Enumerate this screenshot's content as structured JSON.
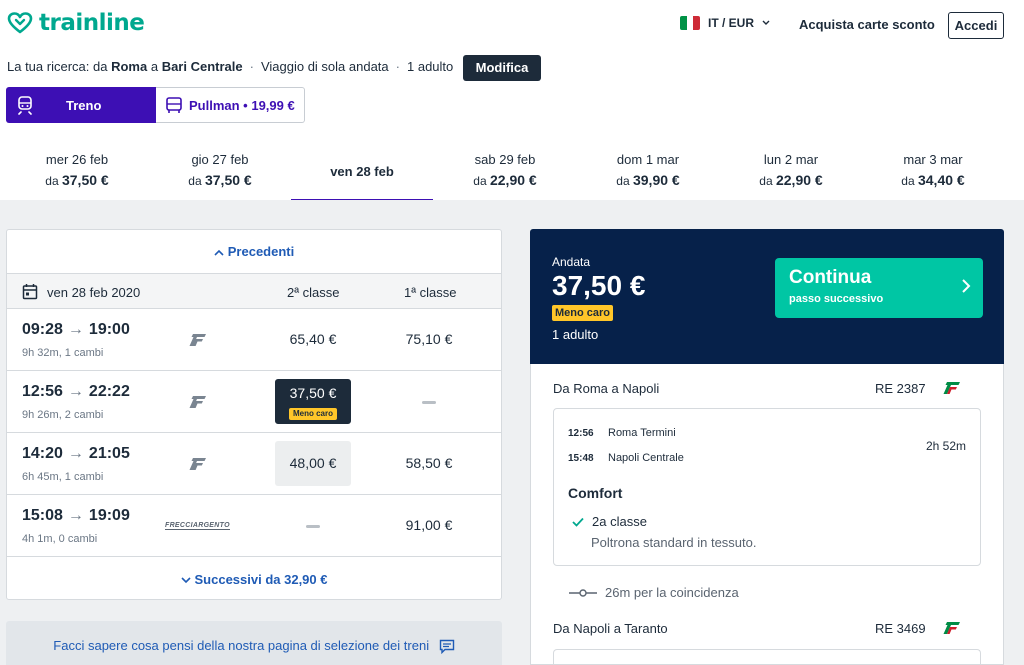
{
  "header": {
    "logo": "trainline",
    "locale": "IT / EUR",
    "buy_cards": "Acquista carte sconto",
    "login": "Accedi"
  },
  "search": {
    "prefix": "La tua ricerca: da",
    "origin": "Roma",
    "connector": "a",
    "destination": "Bari Centrale",
    "trip_type": "Viaggio di sola andata",
    "passengers": "1 adulto",
    "edit": "Modifica"
  },
  "modes": {
    "train": "Treno",
    "bus": "Pullman • 19,99 €"
  },
  "dates": [
    {
      "day": "mer 26 feb",
      "prefix": "da",
      "price": "37,50 €"
    },
    {
      "day": "gio 27 feb",
      "prefix": "da",
      "price": "37,50 €"
    },
    {
      "day": "ven 28 feb",
      "prefix": "",
      "price": ""
    },
    {
      "day": "sab 29 feb",
      "prefix": "da",
      "price": "22,90 €"
    },
    {
      "day": "dom 1 mar",
      "prefix": "da",
      "price": "39,90 €"
    },
    {
      "day": "lun 2 mar",
      "prefix": "da",
      "price": "22,90 €"
    },
    {
      "day": "mar 3 mar",
      "prefix": "da",
      "price": "34,40 €"
    }
  ],
  "results": {
    "previous": "Precedenti",
    "table_date": "ven 28 feb 2020",
    "col_second": "2ª classe",
    "col_first": "1ª classe",
    "next": "Successivi da 32,90 €",
    "rows": [
      {
        "dep": "09:28",
        "arr": "19:00",
        "meta": "9h 32m, 1 cambi",
        "operator": "trenitalia",
        "second": "65,40 €",
        "first": "75,10 €"
      },
      {
        "dep": "12:56",
        "arr": "22:22",
        "meta": "9h 26m, 2 cambi",
        "operator": "trenitalia",
        "second": "37,50 €",
        "second_badge": "Meno caro",
        "first": ""
      },
      {
        "dep": "14:20",
        "arr": "21:05",
        "meta": "6h 45m, 1 cambi",
        "operator": "trenitalia",
        "second": "48,00 €",
        "first": "58,50 €"
      },
      {
        "dep": "15:08",
        "arr": "19:09",
        "meta": "4h 1m, 0 cambi",
        "operator": "FRECCIARGENTO",
        "second": "",
        "first": "91,00 €"
      }
    ]
  },
  "feedback": "Facci sapere cosa pensi della nostra pagina di selezione dei treni",
  "summary": {
    "label": "Andata",
    "price": "37,50 €",
    "badge": "Meno caro",
    "passengers": "1 adulto",
    "continue_title": "Continua",
    "continue_sub": "passo successivo",
    "leg1": {
      "title": "Da Roma a Napoli",
      "code": "RE 2387",
      "dep_time": "12:56",
      "dep_station": "Roma Termini",
      "arr_time": "15:48",
      "arr_station": "Napoli Centrale",
      "duration": "2h 52m",
      "comfort": "Comfort",
      "class": "2a classe",
      "class_desc": "Poltrona standard in tessuto."
    },
    "connection": "26m per la coincidenza",
    "leg2": {
      "title": "Da Napoli a Taranto",
      "code": "RE 3469"
    }
  },
  "colors": {
    "brand_green": "#00a88f",
    "accent_purple": "#3d0fb4",
    "navy": "#06214a",
    "continue_teal": "#00c6a4",
    "badge_yellow": "#ffc629",
    "link_blue": "#1f5bb5"
  }
}
